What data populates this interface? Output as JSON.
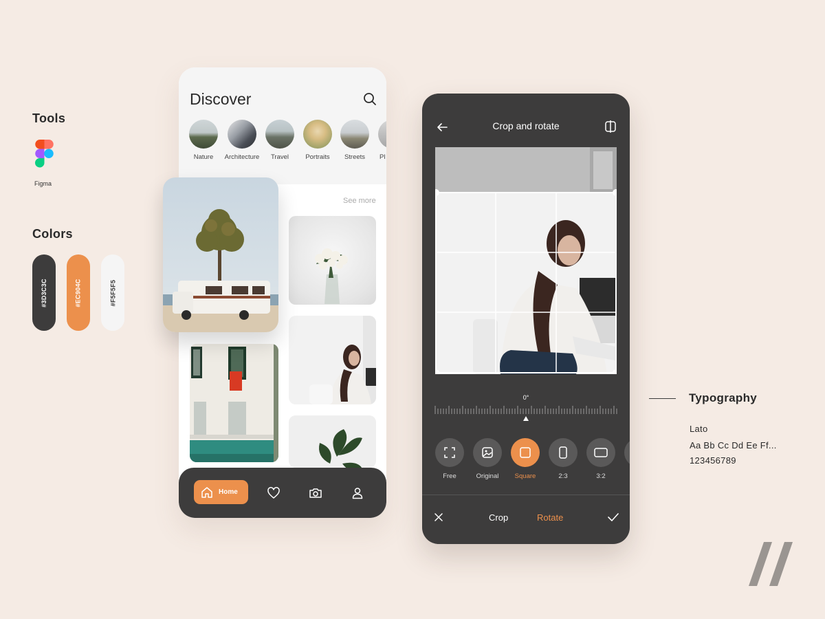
{
  "tools": {
    "title": "Tools",
    "items": [
      {
        "name": "Figma",
        "icon": "figma-logo"
      }
    ]
  },
  "colors": {
    "title": "Colors",
    "swatches": [
      {
        "hex": "#3D3C3C",
        "label": "#3D3C3C"
      },
      {
        "hex": "#EC904C",
        "label": "#EC904C"
      },
      {
        "hex": "#F5F5F5",
        "label": "#F5F5F5"
      }
    ]
  },
  "discover": {
    "title": "Discover",
    "search_icon": "search-icon",
    "categories": [
      {
        "label": "Nature"
      },
      {
        "label": "Architecture"
      },
      {
        "label": "Travel"
      },
      {
        "label": "Portraits"
      },
      {
        "label": "Streets"
      },
      {
        "label": "Pl"
      }
    ],
    "see_more": "See more",
    "tabbar": {
      "home_label": "Home",
      "icons": [
        "home-icon",
        "heart-icon",
        "camera-icon",
        "profile-icon"
      ]
    }
  },
  "editor": {
    "title": "Crop and rotate",
    "rotation": "0°",
    "tools": [
      {
        "label": "Free",
        "icon": "free-crop-icon",
        "active": false
      },
      {
        "label": "Original",
        "icon": "image-icon",
        "active": false
      },
      {
        "label": "Square",
        "icon": "square-icon",
        "active": true
      },
      {
        "label": "2:3",
        "icon": "portrait-ratio-icon",
        "active": false
      },
      {
        "label": "3:2",
        "icon": "landscape-ratio-icon",
        "active": false
      }
    ],
    "bottom": {
      "crop": "Crop",
      "rotate": "Rotate"
    }
  },
  "typography": {
    "title": "Typography",
    "font": "Lato",
    "sample_letters": "Aa Bb Cc Dd Ee Ff...",
    "sample_numbers": "123456789"
  },
  "accent": "#EC904C"
}
